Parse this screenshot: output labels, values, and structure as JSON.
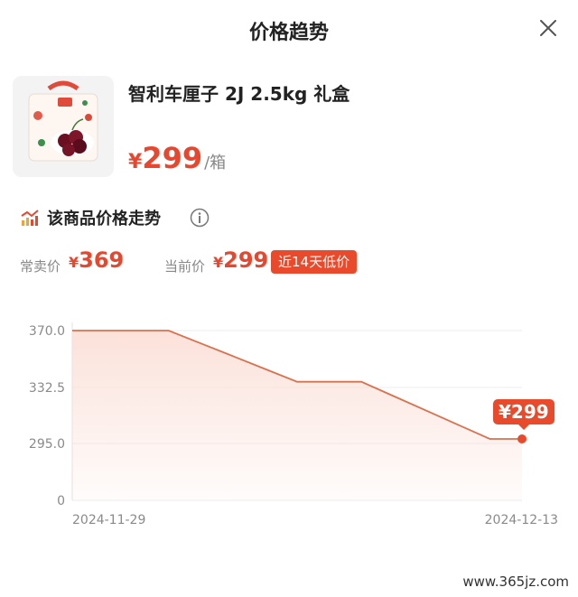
{
  "header": {
    "title": "价格趋势"
  },
  "product": {
    "name": "智利车厘子 2J 2.5kg 礼盒",
    "currency": "¥",
    "price": "299",
    "unit": "/箱"
  },
  "trend": {
    "title": "该商品价格走势",
    "regular_label": "常卖价",
    "regular_currency": "¥",
    "regular_price": "369",
    "current_label": "当前价",
    "current_currency": "¥",
    "current_price": "299",
    "badge": "近14天低价"
  },
  "chart_data": {
    "type": "area",
    "x": [
      "2024-11-29",
      "2024-11-30",
      "2024-12-01",
      "2024-12-02",
      "2024-12-03",
      "2024-12-04",
      "2024-12-05",
      "2024-12-06",
      "2024-12-07",
      "2024-12-08",
      "2024-12-09",
      "2024-12-10",
      "2024-12-11",
      "2024-12-12",
      "2024-12-13"
    ],
    "values": [
      370,
      370,
      370,
      370,
      361.5,
      353,
      344.5,
      336,
      336,
      336,
      326.5,
      317,
      307.5,
      298,
      298
    ],
    "y_ticks": [
      "370.0",
      "332.5",
      "295.0",
      "0"
    ],
    "x_tick_labels": [
      "2024-11-29",
      "2024-12-13"
    ],
    "last_label": "¥299",
    "line_color": "#d9714f",
    "fill_color": "#fbe0d8",
    "grid": true
  },
  "watermark": "www.365jz.com"
}
